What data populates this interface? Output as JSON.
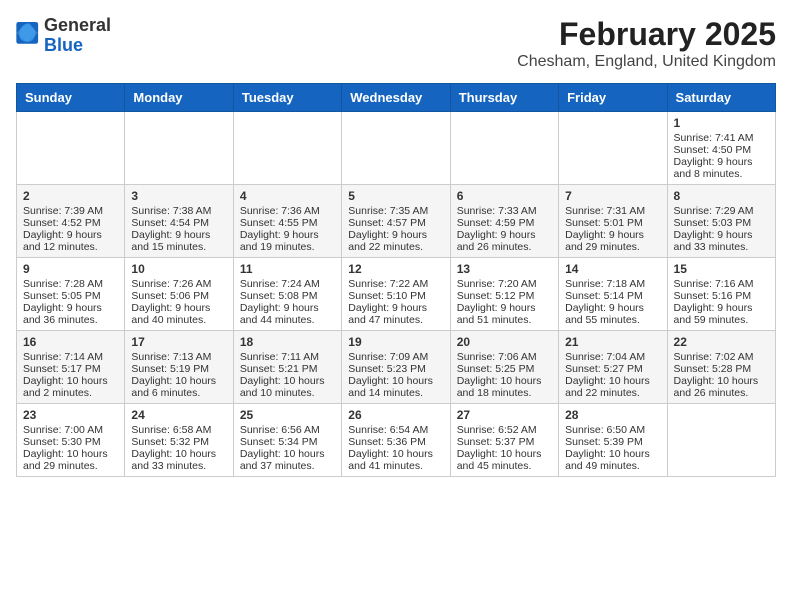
{
  "header": {
    "logo_general": "General",
    "logo_blue": "Blue",
    "title": "February 2025",
    "subtitle": "Chesham, England, United Kingdom"
  },
  "weekdays": [
    "Sunday",
    "Monday",
    "Tuesday",
    "Wednesday",
    "Thursday",
    "Friday",
    "Saturday"
  ],
  "weeks": [
    [
      {
        "day": "",
        "text": ""
      },
      {
        "day": "",
        "text": ""
      },
      {
        "day": "",
        "text": ""
      },
      {
        "day": "",
        "text": ""
      },
      {
        "day": "",
        "text": ""
      },
      {
        "day": "",
        "text": ""
      },
      {
        "day": "1",
        "text": "Sunrise: 7:41 AM\nSunset: 4:50 PM\nDaylight: 9 hours and 8 minutes."
      }
    ],
    [
      {
        "day": "2",
        "text": "Sunrise: 7:39 AM\nSunset: 4:52 PM\nDaylight: 9 hours and 12 minutes."
      },
      {
        "day": "3",
        "text": "Sunrise: 7:38 AM\nSunset: 4:54 PM\nDaylight: 9 hours and 15 minutes."
      },
      {
        "day": "4",
        "text": "Sunrise: 7:36 AM\nSunset: 4:55 PM\nDaylight: 9 hours and 19 minutes."
      },
      {
        "day": "5",
        "text": "Sunrise: 7:35 AM\nSunset: 4:57 PM\nDaylight: 9 hours and 22 minutes."
      },
      {
        "day": "6",
        "text": "Sunrise: 7:33 AM\nSunset: 4:59 PM\nDaylight: 9 hours and 26 minutes."
      },
      {
        "day": "7",
        "text": "Sunrise: 7:31 AM\nSunset: 5:01 PM\nDaylight: 9 hours and 29 minutes."
      },
      {
        "day": "8",
        "text": "Sunrise: 7:29 AM\nSunset: 5:03 PM\nDaylight: 9 hours and 33 minutes."
      }
    ],
    [
      {
        "day": "9",
        "text": "Sunrise: 7:28 AM\nSunset: 5:05 PM\nDaylight: 9 hours and 36 minutes."
      },
      {
        "day": "10",
        "text": "Sunrise: 7:26 AM\nSunset: 5:06 PM\nDaylight: 9 hours and 40 minutes."
      },
      {
        "day": "11",
        "text": "Sunrise: 7:24 AM\nSunset: 5:08 PM\nDaylight: 9 hours and 44 minutes."
      },
      {
        "day": "12",
        "text": "Sunrise: 7:22 AM\nSunset: 5:10 PM\nDaylight: 9 hours and 47 minutes."
      },
      {
        "day": "13",
        "text": "Sunrise: 7:20 AM\nSunset: 5:12 PM\nDaylight: 9 hours and 51 minutes."
      },
      {
        "day": "14",
        "text": "Sunrise: 7:18 AM\nSunset: 5:14 PM\nDaylight: 9 hours and 55 minutes."
      },
      {
        "day": "15",
        "text": "Sunrise: 7:16 AM\nSunset: 5:16 PM\nDaylight: 9 hours and 59 minutes."
      }
    ],
    [
      {
        "day": "16",
        "text": "Sunrise: 7:14 AM\nSunset: 5:17 PM\nDaylight: 10 hours and 2 minutes."
      },
      {
        "day": "17",
        "text": "Sunrise: 7:13 AM\nSunset: 5:19 PM\nDaylight: 10 hours and 6 minutes."
      },
      {
        "day": "18",
        "text": "Sunrise: 7:11 AM\nSunset: 5:21 PM\nDaylight: 10 hours and 10 minutes."
      },
      {
        "day": "19",
        "text": "Sunrise: 7:09 AM\nSunset: 5:23 PM\nDaylight: 10 hours and 14 minutes."
      },
      {
        "day": "20",
        "text": "Sunrise: 7:06 AM\nSunset: 5:25 PM\nDaylight: 10 hours and 18 minutes."
      },
      {
        "day": "21",
        "text": "Sunrise: 7:04 AM\nSunset: 5:27 PM\nDaylight: 10 hours and 22 minutes."
      },
      {
        "day": "22",
        "text": "Sunrise: 7:02 AM\nSunset: 5:28 PM\nDaylight: 10 hours and 26 minutes."
      }
    ],
    [
      {
        "day": "23",
        "text": "Sunrise: 7:00 AM\nSunset: 5:30 PM\nDaylight: 10 hours and 29 minutes."
      },
      {
        "day": "24",
        "text": "Sunrise: 6:58 AM\nSunset: 5:32 PM\nDaylight: 10 hours and 33 minutes."
      },
      {
        "day": "25",
        "text": "Sunrise: 6:56 AM\nSunset: 5:34 PM\nDaylight: 10 hours and 37 minutes."
      },
      {
        "day": "26",
        "text": "Sunrise: 6:54 AM\nSunset: 5:36 PM\nDaylight: 10 hours and 41 minutes."
      },
      {
        "day": "27",
        "text": "Sunrise: 6:52 AM\nSunset: 5:37 PM\nDaylight: 10 hours and 45 minutes."
      },
      {
        "day": "28",
        "text": "Sunrise: 6:50 AM\nSunset: 5:39 PM\nDaylight: 10 hours and 49 minutes."
      },
      {
        "day": "",
        "text": ""
      }
    ]
  ]
}
